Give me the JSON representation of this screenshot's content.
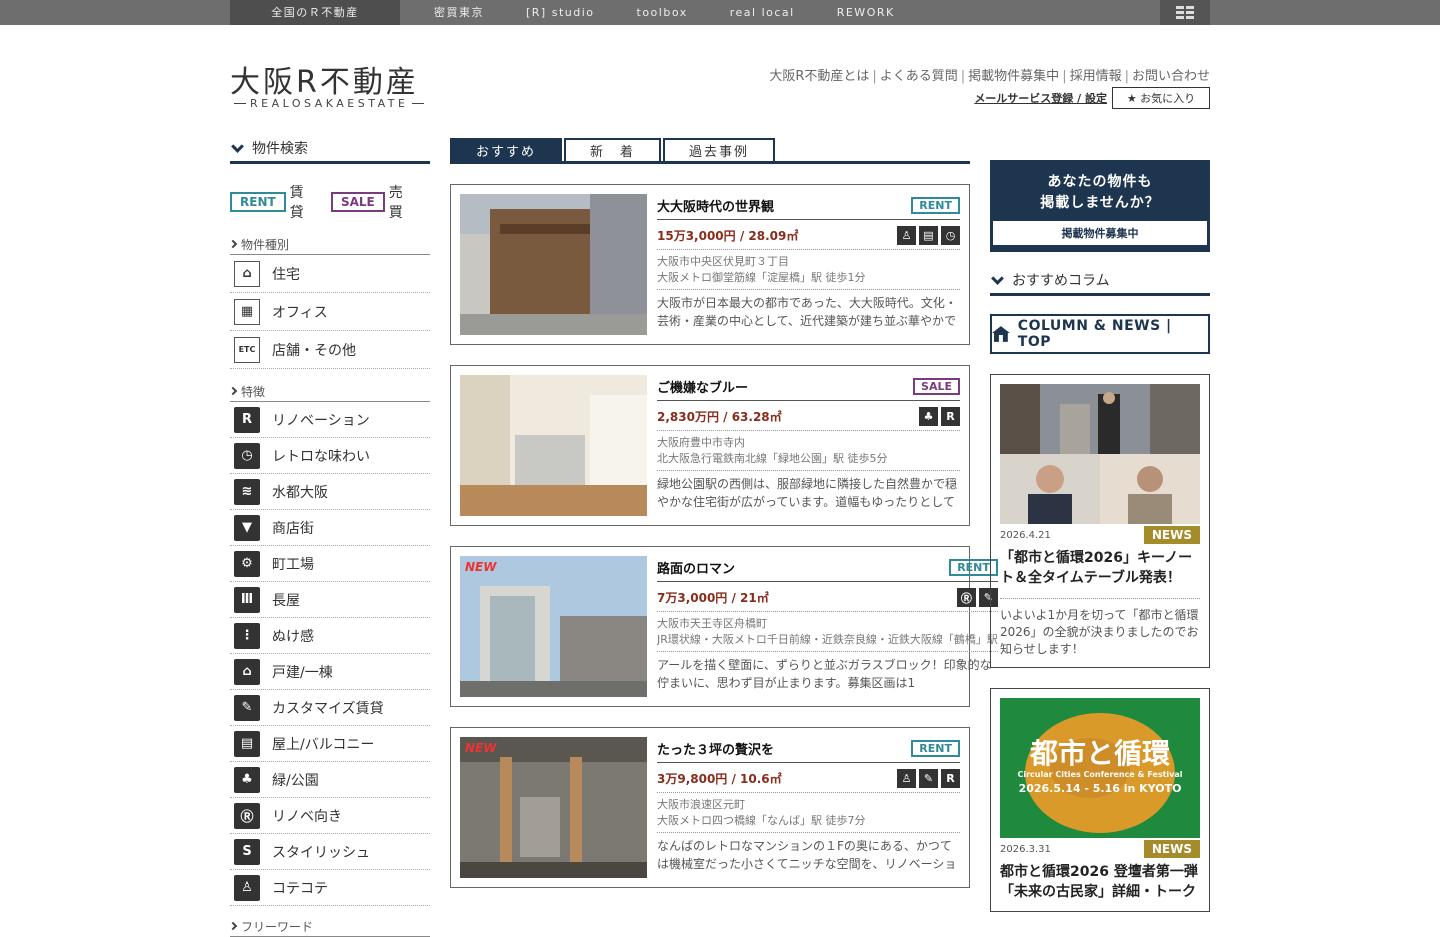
{
  "topnav": {
    "items": [
      "全国のＲ不動産",
      "密買東京",
      "[R] studio",
      "toolbox",
      "real local",
      "REWORK"
    ]
  },
  "header": {
    "logo": "大阪R不動産",
    "logo_sub": "REALOSAKAESTATE",
    "links": [
      "大阪R不動産とは",
      "よくある質問",
      "掲載物件募集中",
      "採用情報",
      "お問い合わせ"
    ],
    "mail_link": "メールサービス登録 / 設定",
    "favorite": "★ お気に入り"
  },
  "sidebar": {
    "title": "物件検索",
    "rent_tag": "RENT",
    "rent_label": "賃貸",
    "sale_tag": "SALE",
    "sale_label": "売買",
    "type_head": "物件種別",
    "types": [
      {
        "label": "住宅",
        "icon": "house-icon",
        "glyph": "⌂"
      },
      {
        "label": "オフィス",
        "icon": "office-icon",
        "glyph": "▦"
      },
      {
        "label": "店舗・その他",
        "icon": "store-icon",
        "glyph": "ETC"
      }
    ],
    "feature_head": "特徴",
    "features": [
      {
        "label": "リノベーション",
        "icon": "renovation-icon",
        "glyph": "R"
      },
      {
        "label": "レトロな味わい",
        "icon": "retro-icon",
        "glyph": "◷"
      },
      {
        "label": "水都大阪",
        "icon": "water-icon",
        "glyph": "≋"
      },
      {
        "label": "商店街",
        "icon": "shopping-street-icon",
        "glyph": "▼"
      },
      {
        "label": "町工場",
        "icon": "factory-icon",
        "glyph": "⚙"
      },
      {
        "label": "長屋",
        "icon": "nagaya-icon",
        "glyph": "Ⅲ"
      },
      {
        "label": "ぬけ感",
        "icon": "openness-icon",
        "glyph": "⋮"
      },
      {
        "label": "戸建/一棟",
        "icon": "detached-house-icon",
        "glyph": "⌂"
      },
      {
        "label": "カスタマイズ賃貸",
        "icon": "customize-icon",
        "glyph": "✎"
      },
      {
        "label": "屋上/バルコニー",
        "icon": "rooftop-icon",
        "glyph": "▤"
      },
      {
        "label": "緑/公園",
        "icon": "park-icon",
        "glyph": "♣"
      },
      {
        "label": "リノベ向き",
        "icon": "renovation-ready-icon",
        "glyph": "Ⓡ"
      },
      {
        "label": "スタイリッシュ",
        "icon": "stylish-icon",
        "glyph": "S"
      },
      {
        "label": "コテコテ",
        "icon": "kotekote-icon",
        "glyph": "♙"
      }
    ],
    "more_head": "フリーワード"
  },
  "tabs": [
    "おすすめ",
    "新　着",
    "過去事例"
  ],
  "listings": [
    {
      "title": "大大阪時代の世界観",
      "tag": "RENT",
      "price": "15万3,000円 / 28.09㎡",
      "icons": [
        "♙",
        "▤",
        "◷"
      ],
      "address": "大阪市中央区伏見町３丁目",
      "access": "大阪メトロ御堂筋線「淀屋橋」駅 徒歩1分",
      "desc": "大阪市が日本最大の都市であった、大大阪時代。文化・芸術・産業の中心として、近代建築が建ち並ぶ華やかで",
      "new": ""
    },
    {
      "title": "ご機嫌なブルー",
      "tag": "SALE",
      "price": "2,830万円 / 63.28㎡",
      "icons": [
        "♣",
        "R"
      ],
      "address": "大阪府豊中市寺内",
      "access": "北大阪急行電鉄南北線「緑地公園」駅 徒歩5分",
      "desc": "緑地公園駅の西側は、服部緑地に隣接した自然豊かで穏やかな住宅街が広がっています。道幅もゆったりとして",
      "new": ""
    },
    {
      "title": "路面のロマン",
      "tag": "RENT",
      "price": "7万3,000円 / 21㎡",
      "icons": [
        "Ⓡ",
        "✎"
      ],
      "address": "大阪市天王寺区舟橋町",
      "access": "JR環状線・大阪メトロ千日前線・近鉄奈良線・近鉄大阪線「鶴橋」駅",
      "desc": "アールを描く壁面に、ずらりと並ぶガラスブロック！印象的な佇まいに、思わず目が止まります。募集区画は1",
      "new": "NEW"
    },
    {
      "title": "たった３坪の贅沢を",
      "tag": "RENT",
      "price": "3万9,800円 / 10.6㎡",
      "icons": [
        "♙",
        "✎",
        "R"
      ],
      "address": "大阪市浪速区元町",
      "access": "大阪メトロ四つ橋線「なんば」駅 徒歩7分",
      "desc": "なんばのレトロなマンションの１Fの奥にある、かつては機械室だった小さくてニッチな空間を、リノベーショ",
      "new": "NEW"
    }
  ],
  "right": {
    "post_text_1": "あなたの物件も",
    "post_text_2": "掲載しませんか？",
    "post_btn": "掲載物件募集中",
    "column_title": "おすすめコラム",
    "column_top": "COLUMN & NEWS | TOP",
    "cards": [
      {
        "date": "2026.4.21",
        "tag": "NEWS",
        "title": "「都市と循環2026」キーノート＆全タイムテーブル発表！",
        "text": "いよいよ1か月を切って「都市と循環2026」の全貌が決まりましたのでお知らせします！"
      },
      {
        "date": "2026.3.31",
        "tag": "NEWS",
        "title": "都市と循環2026 登壇者第一弾「未来の古民家」詳細・トーク",
        "img_title": "都市と循環",
        "img_sub": "Circular Cities Conference & Festival",
        "img_date": "2026.5.14 - 5.16 in KYOTO"
      }
    ]
  }
}
